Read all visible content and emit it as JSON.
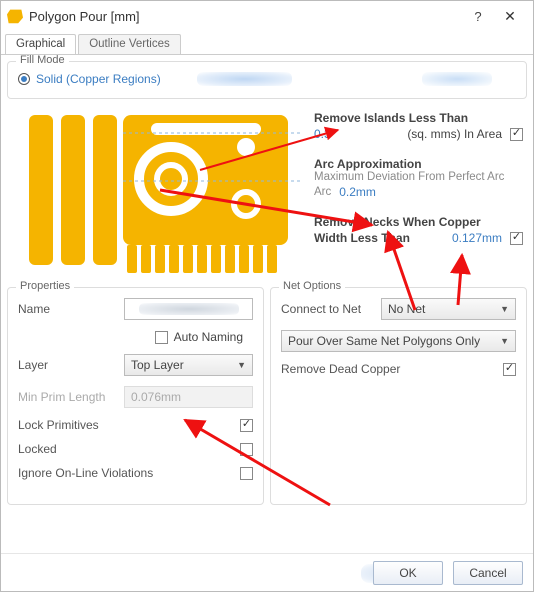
{
  "window": {
    "title": "Polygon Pour [mm]"
  },
  "tabs": {
    "graphical": "Graphical",
    "outline": "Outline Vertices"
  },
  "fillmode": {
    "title": "Fill Mode",
    "solid": "Solid (Copper Regions)"
  },
  "params": {
    "removeIslands": {
      "title": "Remove Islands Less Than",
      "value": "0.3",
      "suffix": "(sq. mms) In Area",
      "checked": true
    },
    "arc": {
      "title": "Arc Approximation",
      "sub": "Maximum Deviation From Perfect Arc",
      "value": "0.2mm"
    },
    "removeNecks": {
      "title1": "Remove Necks When Copper",
      "title2": "Width Less Than",
      "value": "0.127mm",
      "checked": true
    }
  },
  "properties": {
    "sectionTitle": "Properties",
    "nameLabel": "Name",
    "autoNaming": "Auto Naming",
    "autoNamingChecked": false,
    "layerLabel": "Layer",
    "layerValue": "Top Layer",
    "minPrimLabel": "Min Prim Length",
    "minPrimValue": "0.076mm",
    "lockPrimLabel": "Lock Primitives",
    "lockPrimChecked": true,
    "lockedLabel": "Locked",
    "lockedChecked": false,
    "ignoreLabel": "Ignore On-Line Violations",
    "ignoreChecked": false
  },
  "netopts": {
    "sectionTitle": "Net Options",
    "connectLabel": "Connect to Net",
    "connectValue": "No Net",
    "pourRule": "Pour Over Same Net Polygons Only",
    "deadCopperLabel": "Remove Dead Copper",
    "deadCopperChecked": true
  },
  "footer": {
    "ok": "OK",
    "cancel": "Cancel"
  }
}
